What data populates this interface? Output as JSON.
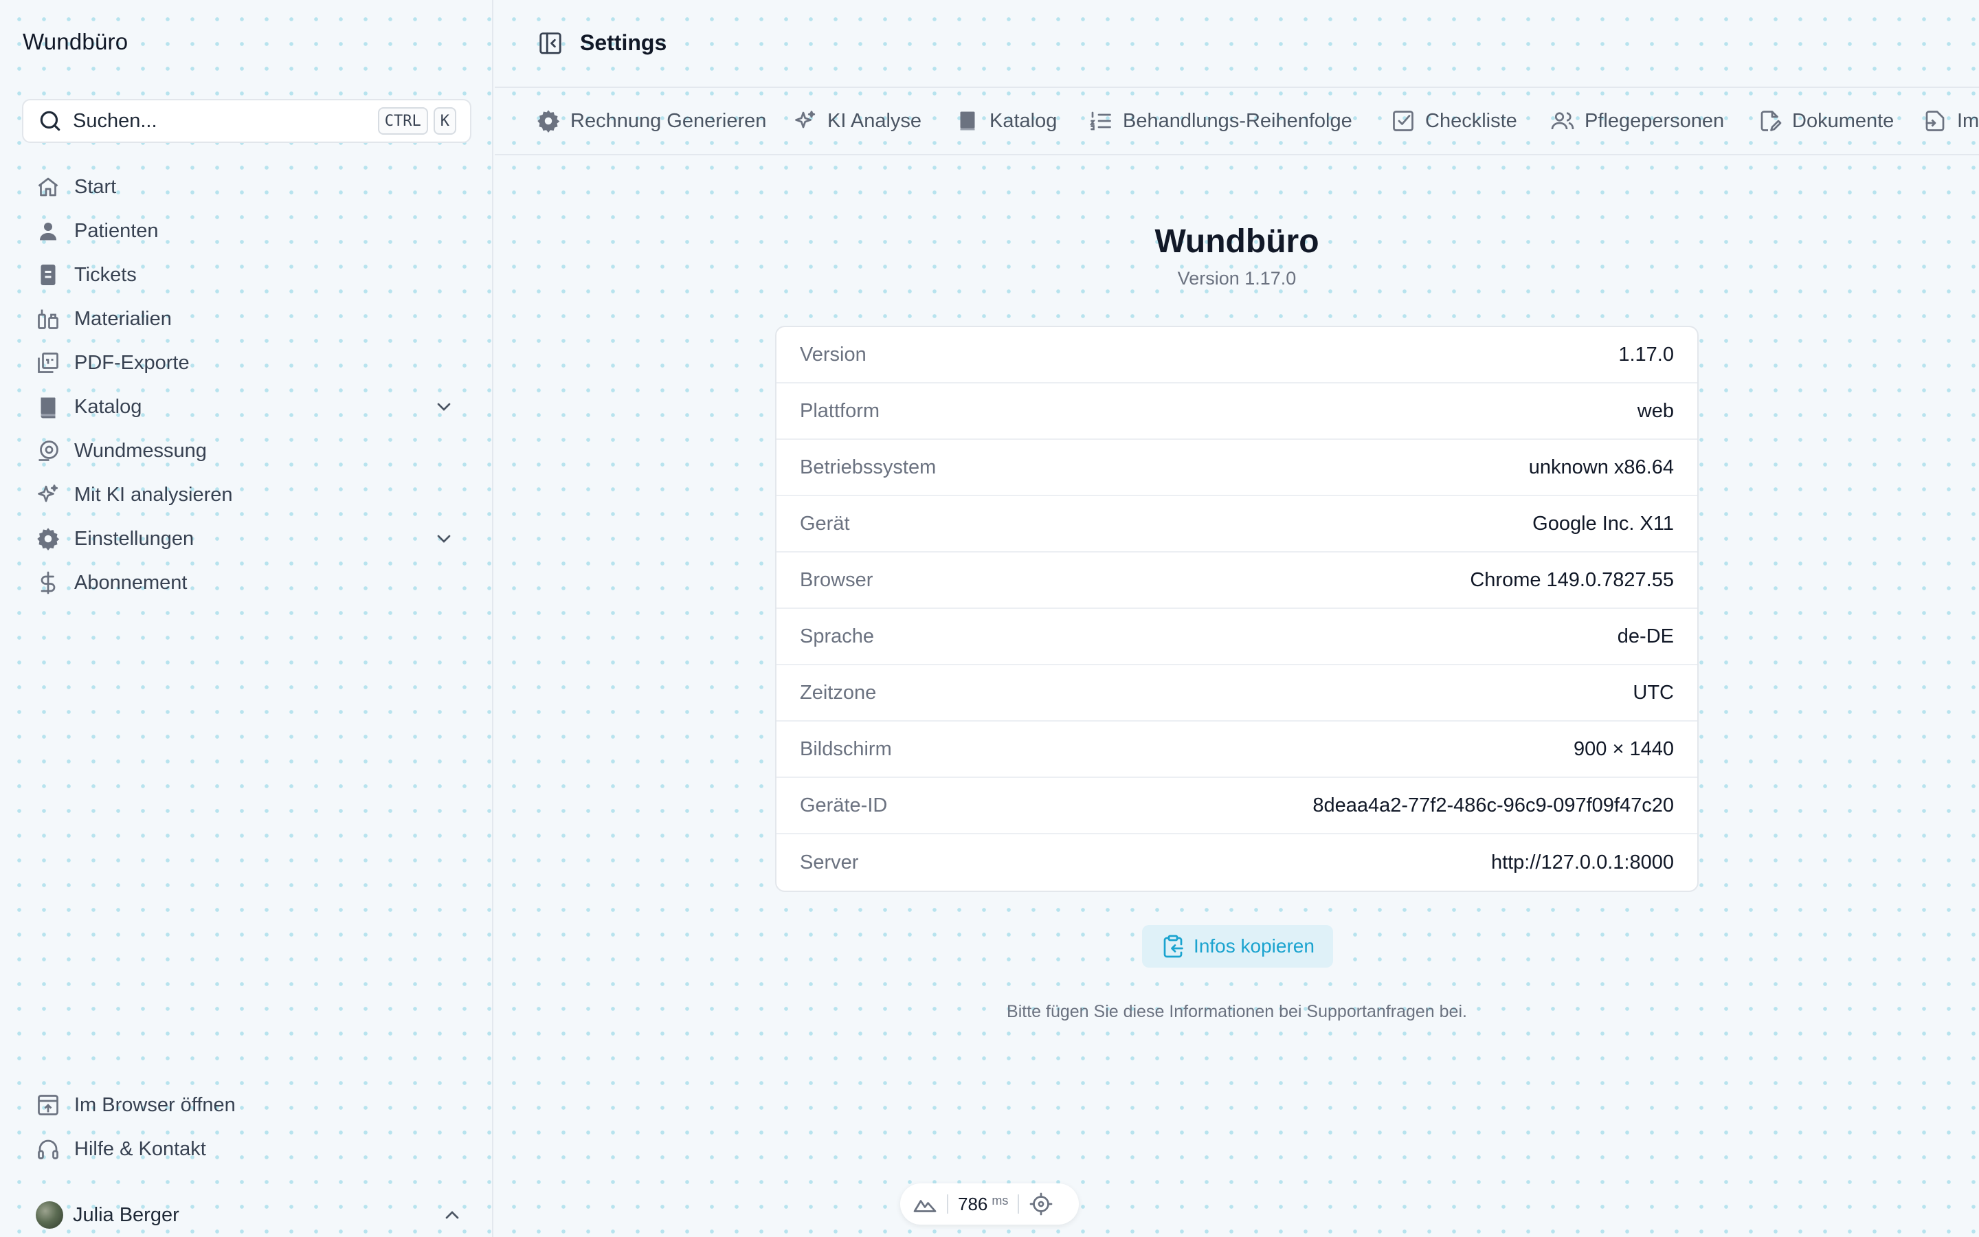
{
  "sidebar": {
    "brand": "Wundbüro",
    "search": {
      "label": "Suchen...",
      "shortcut_keys": [
        "CTRL",
        "K"
      ]
    },
    "nav": [
      {
        "label": "Start",
        "icon": "home-icon"
      },
      {
        "label": "Patienten",
        "icon": "user-icon"
      },
      {
        "label": "Tickets",
        "icon": "ticket-icon"
      },
      {
        "label": "Materialien",
        "icon": "materials-icon"
      },
      {
        "label": "PDF-Exporte",
        "icon": "pdf-icon"
      },
      {
        "label": "Katalog",
        "icon": "book-icon",
        "expandable": true
      },
      {
        "label": "Wundmessung",
        "icon": "measure-icon"
      },
      {
        "label": "Mit KI analysieren",
        "icon": "sparkles-icon"
      },
      {
        "label": "Einstellungen",
        "icon": "gear-icon",
        "expandable": true
      },
      {
        "label": "Abonnement",
        "icon": "dollar-icon"
      }
    ],
    "bottom_nav": [
      {
        "label": "Im Browser öffnen",
        "icon": "open-browser-icon"
      },
      {
        "label": "Hilfe & Kontakt",
        "icon": "headset-icon"
      }
    ],
    "user": {
      "name": "Julia Berger"
    }
  },
  "header": {
    "title": "Settings"
  },
  "tabs": [
    {
      "label": "Rechnung Generieren",
      "icon": "gear-icon"
    },
    {
      "label": "KI Analyse",
      "icon": "sparkles-icon"
    },
    {
      "label": "Katalog",
      "icon": "book-icon"
    },
    {
      "label": "Behandlungs-Reihenfolge",
      "icon": "list-ordered-icon"
    },
    {
      "label": "Checkliste",
      "icon": "checkbox-icon"
    },
    {
      "label": "Pflegepersonen",
      "icon": "users-icon"
    },
    {
      "label": "Dokumente",
      "icon": "document-edit-icon"
    },
    {
      "label": "Im",
      "icon": "import-icon"
    }
  ],
  "about": {
    "app_name": "Wundbüro",
    "version_line": "Version 1.17.0",
    "rows": [
      {
        "key": "Version",
        "value": "1.17.0"
      },
      {
        "key": "Plattform",
        "value": "web"
      },
      {
        "key": "Betriebssystem",
        "value": "unknown x86.64"
      },
      {
        "key": "Gerät",
        "value": "Google Inc. X11"
      },
      {
        "key": "Browser",
        "value": "Chrome 149.0.7827.55"
      },
      {
        "key": "Sprache",
        "value": "de-DE"
      },
      {
        "key": "Zeitzone",
        "value": "UTC"
      },
      {
        "key": "Bildschirm",
        "value": "900 × 1440"
      },
      {
        "key": "Geräte-ID",
        "value": "8deaa4a2-77f2-486c-96c9-097f09f47c20"
      },
      {
        "key": "Server",
        "value": "http://127.0.0.1:8000"
      }
    ],
    "copy_button": "Infos kopieren",
    "hint": "Bitte fügen Sie diese Informationen bei Supportanfragen bei."
  },
  "perf": {
    "value": "786",
    "unit": "ms"
  },
  "colors": {
    "accent": "#1aa3cf",
    "accent_bg": "#dff1f8",
    "dots": "#b7e3ee"
  }
}
